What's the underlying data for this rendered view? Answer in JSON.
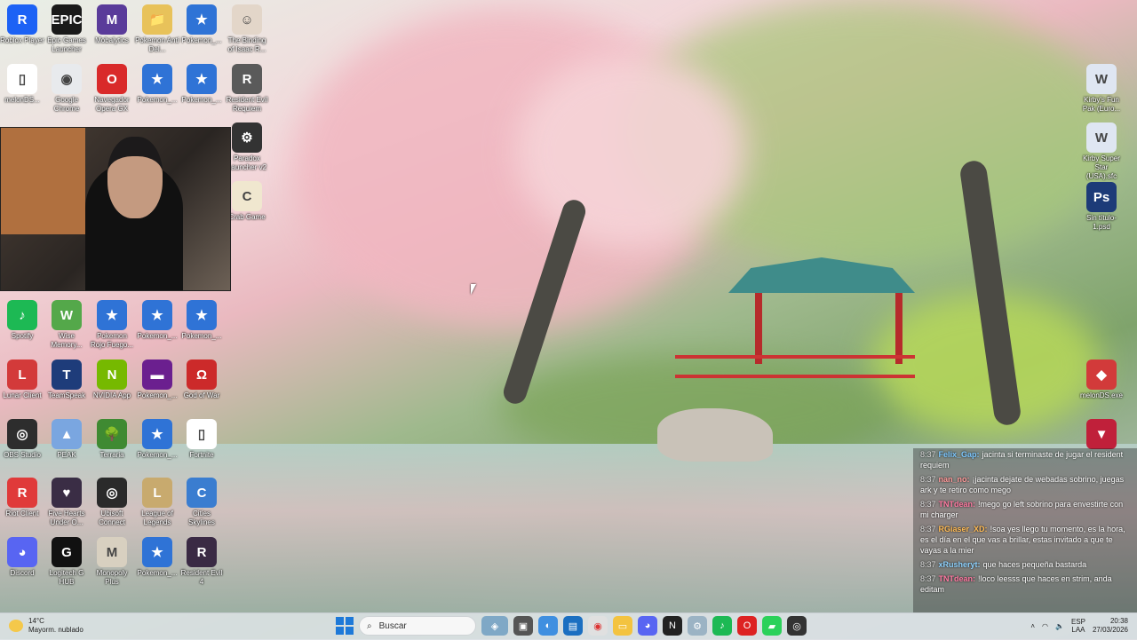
{
  "desktop_icons": [
    {
      "label": "Roblox Player",
      "color": "#1c62f5",
      "glyph": "R"
    },
    {
      "label": "Epic Games Launcher",
      "color": "#1a1a1a",
      "glyph": "EPIC"
    },
    {
      "label": "Mobalytics",
      "color": "#5a3b9a",
      "glyph": "M"
    },
    {
      "label": "Pokemon Antí Del...",
      "color": "#e8c25a",
      "glyph": "📁"
    },
    {
      "label": "Pokemon_...",
      "color": "#2f73d6",
      "glyph": "★"
    },
    {
      "label": "The Binding of Isaac R...",
      "color": "#e3d6c9",
      "glyph": "☺"
    },
    {
      "label": "melonDS...",
      "color": "#ffffff",
      "glyph": "▯"
    },
    {
      "label": "Google Chrome",
      "color": "#e8eaed",
      "glyph": "◉"
    },
    {
      "label": "Navegador Opera GX",
      "color": "#d92a2a",
      "glyph": "O"
    },
    {
      "label": "Pokemon_...",
      "color": "#2f73d6",
      "glyph": "★"
    },
    {
      "label": "Pokemon_...",
      "color": "#2f73d6",
      "glyph": "★"
    },
    {
      "label": "Resident Evil Requiem",
      "color": "#5a5a5a",
      "glyph": "R"
    },
    {
      "label": "Paradox Launcher v2",
      "color": "#333333",
      "glyph": "⚙"
    },
    {
      "label": "Crab Game",
      "color": "#f0e7cf",
      "glyph": "C"
    },
    {
      "label": "Spotify",
      "color": "#1db954",
      "glyph": "♪"
    },
    {
      "label": "Wise Memory...",
      "color": "#54a84a",
      "glyph": "W"
    },
    {
      "label": "Pokemon Rojo Fuego...",
      "color": "#2f73d6",
      "glyph": "★"
    },
    {
      "label": "Pokemon_...",
      "color": "#2f73d6",
      "glyph": "★"
    },
    {
      "label": "Pokemon_...",
      "color": "#2f73d6",
      "glyph": "★"
    },
    {
      "label": "Lunar Client",
      "color": "#d33a3a",
      "glyph": "L"
    },
    {
      "label": "TeamSpeak",
      "color": "#1e3c7a",
      "glyph": "T"
    },
    {
      "label": "NVIDIA App",
      "color": "#76b900",
      "glyph": "N"
    },
    {
      "label": "Pokemon_...",
      "color": "#6b1f8f",
      "glyph": "▬"
    },
    {
      "label": "God of War",
      "color": "#cc2a2a",
      "glyph": "Ω"
    },
    {
      "label": "OBS Studio",
      "color": "#2d2d2d",
      "glyph": "◎"
    },
    {
      "label": "PEAK",
      "color": "#7aa6e0",
      "glyph": "▲"
    },
    {
      "label": "Terraria",
      "color": "#3f8a32",
      "glyph": "🌳"
    },
    {
      "label": "Pokemon_...",
      "color": "#2f73d6",
      "glyph": "★"
    },
    {
      "label": "Fortnite",
      "color": "#ffffff",
      "glyph": "▯"
    },
    {
      "label": "Riot Client",
      "color": "#e03a3a",
      "glyph": "R"
    },
    {
      "label": "Five Hearts Under O...",
      "color": "#3a2d45",
      "glyph": "♥"
    },
    {
      "label": "Ubisoft Connect",
      "color": "#2a2a2a",
      "glyph": "◎"
    },
    {
      "label": "League of Legends",
      "color": "#c8aa6e",
      "glyph": "L"
    },
    {
      "label": "Cities Skylines",
      "color": "#3a7dd0",
      "glyph": "C"
    },
    {
      "label": "Discord",
      "color": "#5865f2",
      "glyph": "◕"
    },
    {
      "label": "Logitech G HUB",
      "color": "#111111",
      "glyph": "G"
    },
    {
      "label": "Monopoly Plus",
      "color": "#d8d0c0",
      "glyph": "M"
    },
    {
      "label": "Pokemon_...",
      "color": "#2f73d6",
      "glyph": "★"
    },
    {
      "label": "Resident Evil 4",
      "color": "#3a2a44",
      "glyph": "R"
    }
  ],
  "right_icons": [
    {
      "label": "Kirby's Fun Pak (Euro...",
      "color": "#dfe6f2",
      "glyph": "W"
    },
    {
      "label": "Kirby Super Star (USA).sfc",
      "color": "#dfe6f2",
      "glyph": "W"
    },
    {
      "label": "Sin título-1.psd",
      "color": "#1d3b78",
      "glyph": "Ps"
    },
    {
      "label": "melonDS.exe",
      "color": "#d23a3a",
      "glyph": "◆"
    },
    {
      "label": "",
      "color": "#c0203a",
      "glyph": "▼"
    }
  ],
  "chat": [
    {
      "time": "8:37",
      "user": "Felix_Gap:",
      "user_color": "#7ec8ff",
      "text": "jacinta si terminaste de jugar el resident requiem"
    },
    {
      "time": "8:37",
      "user": "nan_no:",
      "user_color": "#ff9b9b",
      "text": "¡jacinta dejate de webadas sobrino, juegas ark y te retiro como mego"
    },
    {
      "time": "8:37",
      "user": "TNTdean:",
      "user_color": "#ff7aa2",
      "text": "!mego go left sobrino para envestirte con mi charger"
    },
    {
      "time": "8:37",
      "user": "RGiaser_XD:",
      "user_color": "#ffbb55",
      "text": "!soa yes llego tu momento, es la hora, es el día en el que vas a brillar, estas invitado a que te vayas a la mier"
    },
    {
      "time": "8:37",
      "user": "xRusheryt:",
      "user_color": "#8fd3ff",
      "text": "que haces pequeña bastarda"
    },
    {
      "time": "8:37",
      "user": "TNTdean:",
      "user_color": "#ff7aa2",
      "text": "!loco leesss que haces en strim, anda editam"
    }
  ],
  "taskbar": {
    "weather_temp": "14°C",
    "weather_desc": "Mayorm. nublado",
    "search_placeholder": "Buscar",
    "lang_top": "ESP",
    "lang_bottom": "LAA",
    "time": "20:38",
    "date": "27/03/2026"
  }
}
